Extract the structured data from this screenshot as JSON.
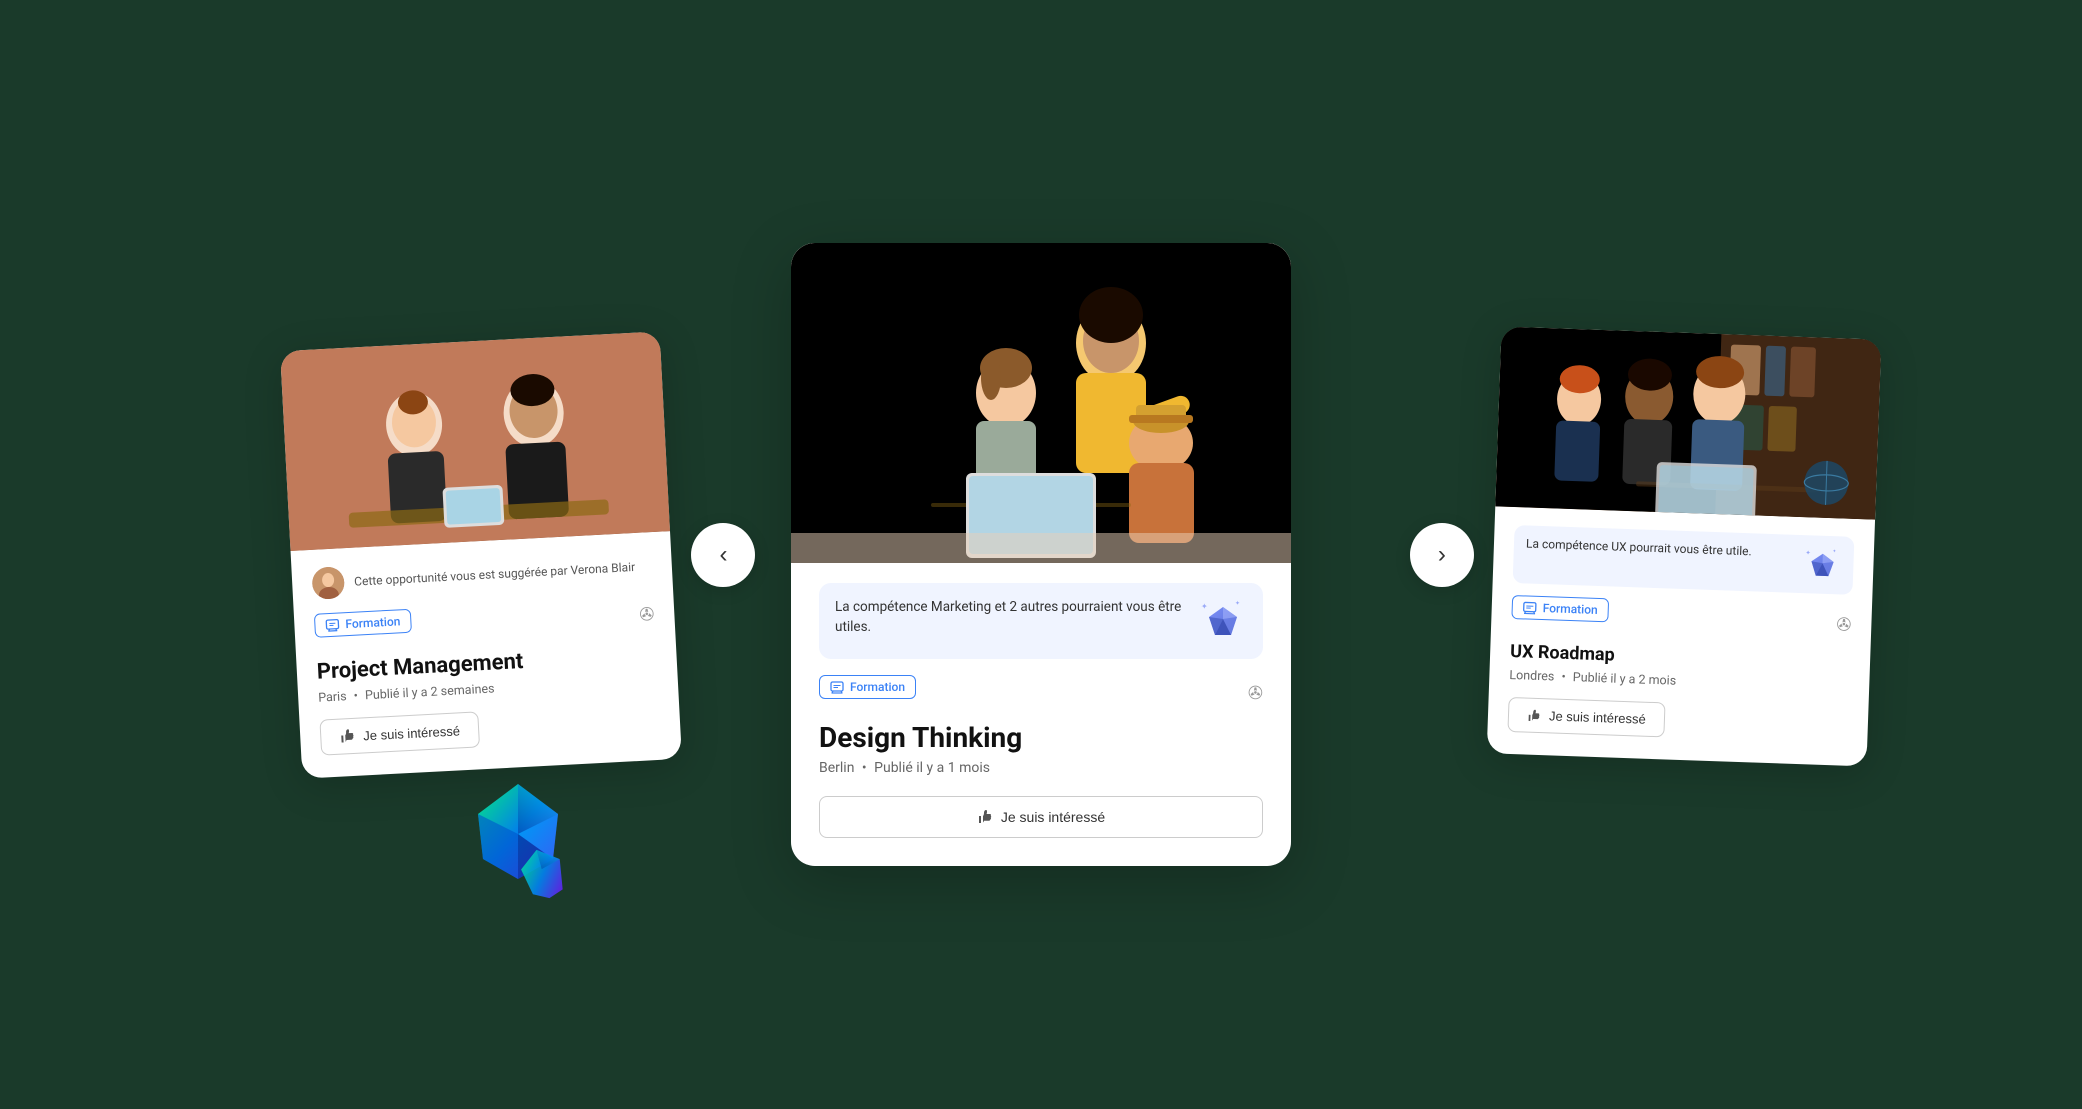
{
  "background_color": "#1a3a2a",
  "carousel": {
    "nav_left_label": "‹",
    "nav_right_label": "›"
  },
  "cards": {
    "left": {
      "suggestion_text": "Cette opportunité vous est suggérée par Verona Blair",
      "badge_label": "Formation",
      "title": "Project Management",
      "location": "Paris",
      "published": "Publié il y a 2 semaines",
      "interest_btn": "Je suis intéressé"
    },
    "center": {
      "skill_suggestion_text": "La compétence Marketing et 2 autres pourraient vous être utiles.",
      "badge_label": "Formation",
      "title": "Design Thinking",
      "location": "Berlin",
      "published": "Publié il y a 1 mois",
      "interest_btn": "Je suis intéressé"
    },
    "right": {
      "skill_suggestion_text": "La compétence UX pourrait vous être utile.",
      "badge_label": "Formation",
      "title": "UX Roadmap",
      "location": "Londres",
      "published": "Publié il y a 2 mois",
      "interest_btn": "Je suis intéressé"
    }
  }
}
